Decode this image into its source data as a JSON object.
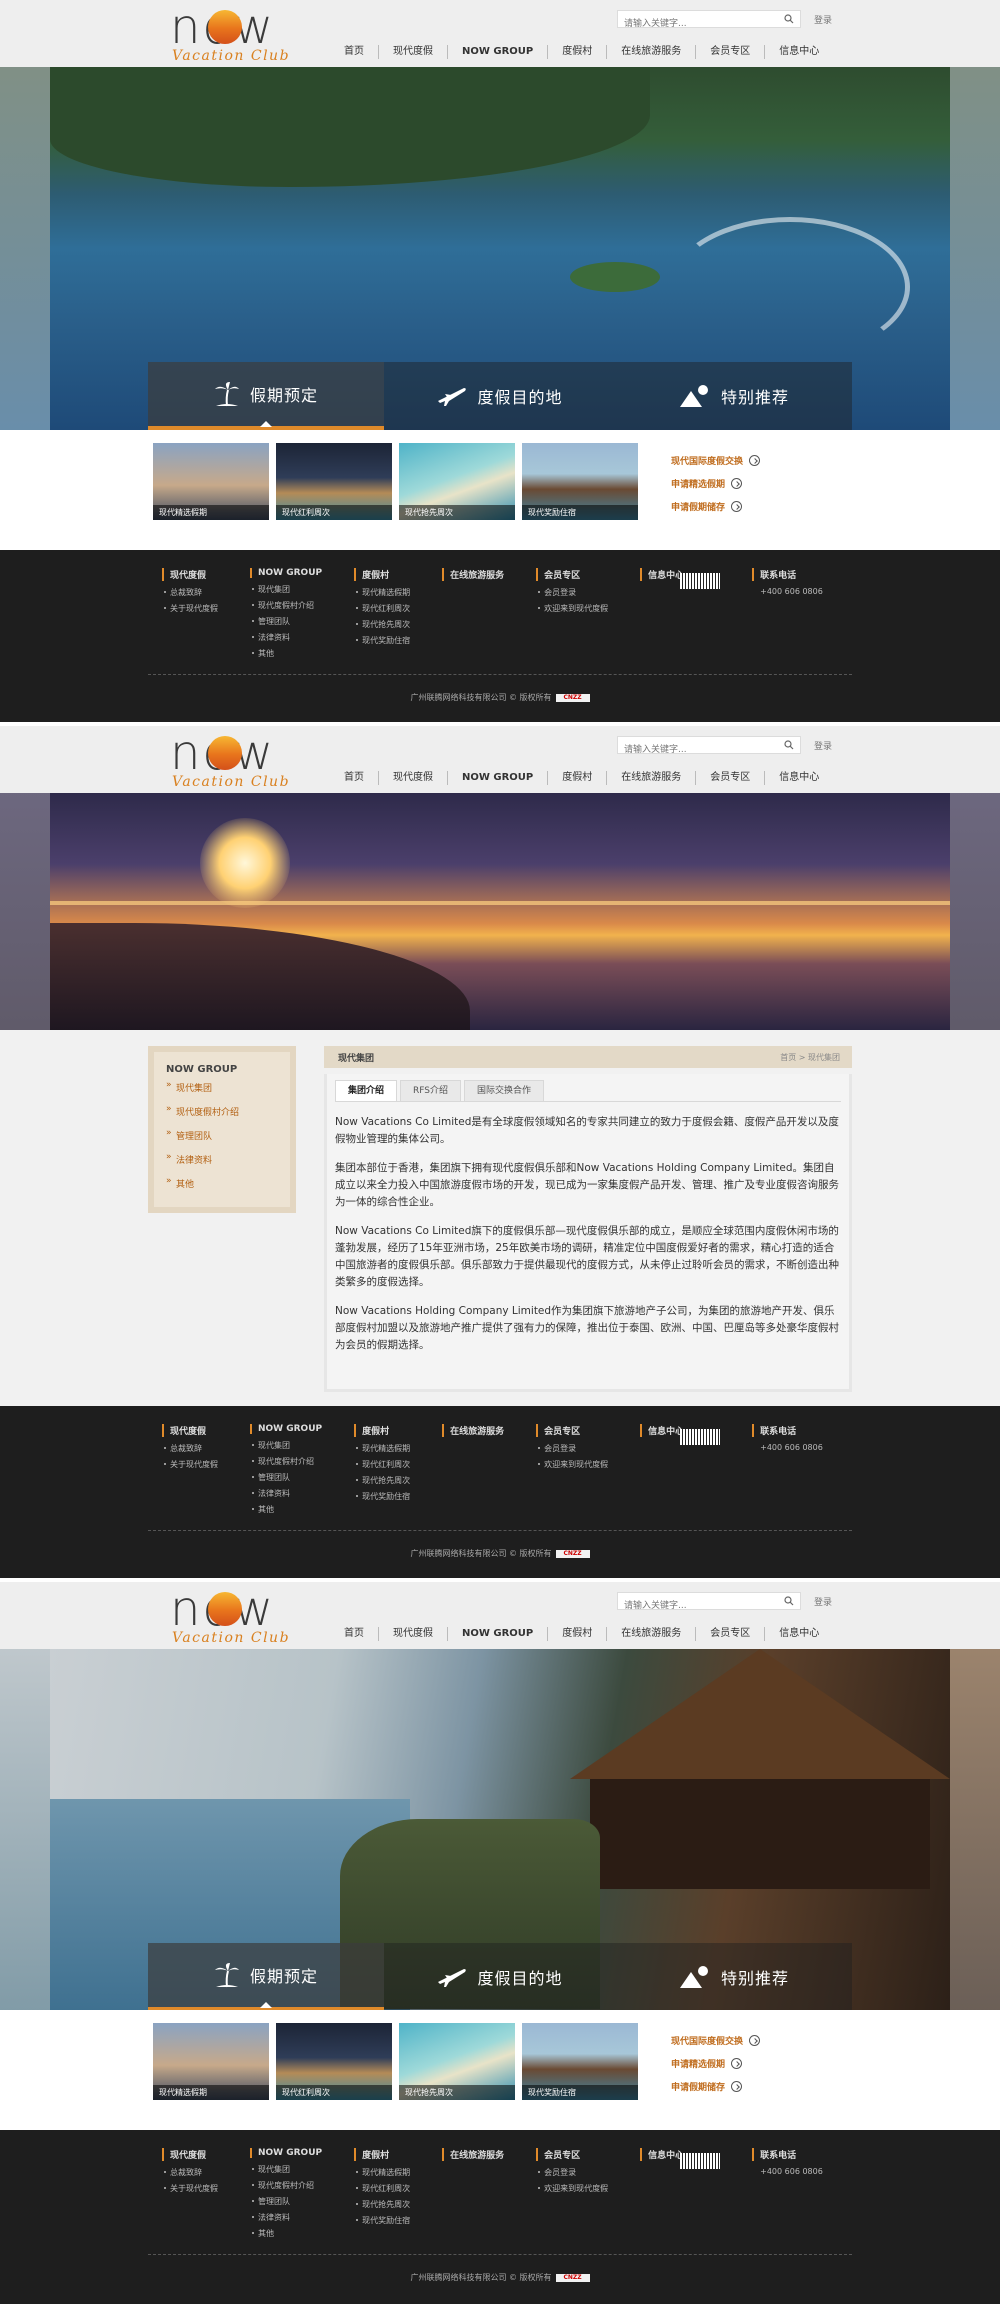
{
  "logo": {
    "word": "now",
    "sub": "Vacation Club"
  },
  "search": {
    "placeholder": "请输入关键字..."
  },
  "login": "登录",
  "nav": [
    "首页",
    "现代度假",
    "NOW GROUP",
    "度假村",
    "在线旅游服务",
    "会员专区",
    "信息中心"
  ],
  "booking_tabs": [
    {
      "label": "假期预定",
      "icon": "palm-tree-icon"
    },
    {
      "label": "度假目的地",
      "icon": "airplane-icon"
    },
    {
      "label": "特别推荐",
      "icon": "mountain-icon"
    }
  ],
  "thumbnails": [
    "现代精选假期",
    "现代红利周次",
    "现代抢先周次",
    "现代奖励住宿"
  ],
  "quick_links": [
    "现代国际度假交换",
    "申请精选假期",
    "申请假期储存"
  ],
  "footer": {
    "columns": [
      {
        "title": "现代度假",
        "items": [
          "总裁致辞",
          "关于现代度假"
        ]
      },
      {
        "title": "NOW GROUP",
        "items": [
          "现代集团",
          "现代度假村介绍",
          "管理团队",
          "法律资料",
          "其他"
        ]
      },
      {
        "title": "度假村",
        "items": [
          "现代精选假期",
          "现代红利周次",
          "现代抢先周次",
          "现代奖励住宿"
        ]
      },
      {
        "title": "在线旅游服务",
        "items": []
      },
      {
        "title": "会员专区",
        "items": [
          "会员登录",
          "欢迎来到现代度假"
        ]
      },
      {
        "title": "信息中心",
        "items": []
      },
      {
        "title": "联系电话",
        "items": [
          "+400 606 0806"
        ]
      }
    ],
    "copyright": "广州联腾网络科技有限公司 © 版权所有",
    "badge": "CNZZ"
  },
  "about": {
    "side_title": "NOW GROUP",
    "side_items": [
      "现代集团",
      "现代度假村介绍",
      "管理团队",
      "法律资料",
      "其他"
    ],
    "panel_title": "现代集团",
    "breadcrumb": "首页 > 现代集团",
    "subtabs": [
      "集团介绍",
      "RFS介绍",
      "国际交换合作"
    ],
    "paragraphs": [
      "Now Vacations Co Limited是有全球度假领域知名的专家共同建立的致力于度假会籍、度假产品开发以及度假物业管理的集体公司。",
      "集团本部位于香港，集团旗下拥有现代度假俱乐部和Now Vacations Holding Company Limited。集团自成立以来全力投入中国旅游度假市场的开发，现已成为一家集度假产品开发、管理、推广及专业度假咨询服务为一体的综合性企业。",
      "Now Vacations Co Limited旗下的度假俱乐部—现代度假俱乐部的成立，是顺应全球范围内度假休闲市场的蓬勃发展，经历了15年亚洲市场，25年欧美市场的调研，精准定位中国度假爱好者的需求，精心打造的适合中国旅游者的度假俱乐部。俱乐部致力于提供最现代的度假方式，从未停止过聆听会员的需求，不断创造出种类繁多的度假选择。",
      "Now Vacations Holding Company Limited作为集团旗下旅游地产子公司，为集团的旅游地产开发、俱乐部度假村加盟以及旅游地产推广提供了强有力的保障，推出位于泰国、欧洲、中国、巴厘岛等多处豪华度假村为会员的假期选择。"
    ]
  },
  "colors": {
    "accent": "#e08a2a",
    "link": "#c06d1f",
    "footer_bg": "#1e1e1e",
    "header_bg": "#eeeeee"
  }
}
